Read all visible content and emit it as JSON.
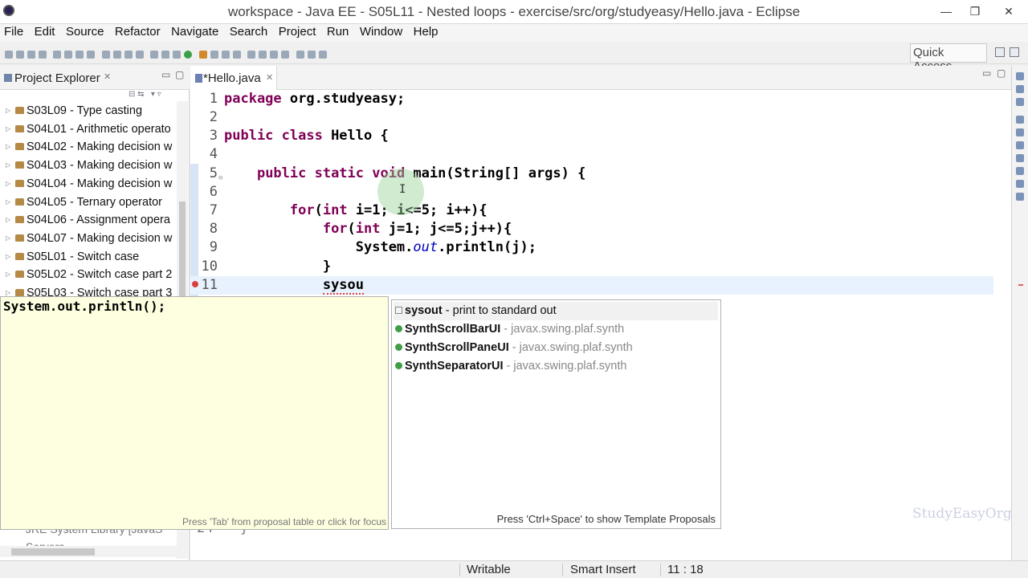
{
  "window": {
    "title": "workspace - Java EE - S05L11 - Nested loops - exercise/src/org/studyeasy/Hello.java - Eclipse",
    "minimize_glyph": "—",
    "maximize_glyph": "❐",
    "close_glyph": "✕"
  },
  "menubar": [
    "File",
    "Edit",
    "Source",
    "Refactor",
    "Navigate",
    "Search",
    "Project",
    "Run",
    "Window",
    "Help"
  ],
  "toolbar": {
    "quick_access_placeholder": "Quick Access"
  },
  "explorer": {
    "title": "Project Explorer",
    "close_glyph": "✕",
    "items": [
      "S03L09 - Type casting",
      "S04L01 - Arithmetic operato",
      "S04L02 - Making decision w",
      "S04L03 - Making decision w",
      "S04L04 - Making decision w",
      "S04L05 - Ternary operator",
      "S04L06 - Assignment opera",
      "S04L07 - Making decision w",
      "S05L01 - Switch case",
      "S05L02 - Switch case part 2",
      "S05L03 - Switch case part 3"
    ],
    "hidden_items": [
      "JRE System Library [JavaS",
      "Servers"
    ]
  },
  "editor": {
    "tab_label": "*Hello.java",
    "tab_close_glyph": "✕",
    "lines": [
      {
        "num": "1",
        "text": "package org.studyeasy;"
      },
      {
        "num": "2",
        "text": ""
      },
      {
        "num": "3",
        "text": "public class Hello {"
      },
      {
        "num": "4",
        "text": ""
      },
      {
        "num": "5",
        "text": "    public static void main(String[] args) {"
      },
      {
        "num": "6",
        "text": ""
      },
      {
        "num": "7",
        "text": "        for(int i=1; i<=5; i++){"
      },
      {
        "num": "8",
        "text": "            for(int j=1; j<=5;j++){"
      },
      {
        "num": "9",
        "text": "                System.out.println(j);"
      },
      {
        "num": "10",
        "text": "            }"
      },
      {
        "num": "11",
        "text": "            sysou"
      }
    ],
    "hidden_line": {
      "num": "24",
      "text": "}"
    }
  },
  "template_popup": {
    "code": "System.out.println();",
    "hint": "Press 'Tab' from proposal table or click for focus"
  },
  "proposals": {
    "items": [
      {
        "name": "sysout",
        "detail": " - print to standard out",
        "kind": "template"
      },
      {
        "name": "SynthScrollBarUI",
        "detail": " - javax.swing.plaf.synth",
        "kind": "class"
      },
      {
        "name": "SynthScrollPaneUI",
        "detail": " - javax.swing.plaf.synth",
        "kind": "class"
      },
      {
        "name": "SynthSeparatorUI",
        "detail": " - javax.swing.plaf.synth",
        "kind": "class"
      }
    ],
    "hint": "Press 'Ctrl+Space' to show Template Proposals"
  },
  "statusbar": {
    "writable": "Writable",
    "insert_mode": "Smart Insert",
    "position": "11 : 18"
  },
  "watermark": "StudyEasyOrg",
  "colors": {
    "keyword": "#7f0055",
    "field": "#0000c0",
    "current_line": "#e8f2fe",
    "popup_bg": "#fefee0"
  }
}
